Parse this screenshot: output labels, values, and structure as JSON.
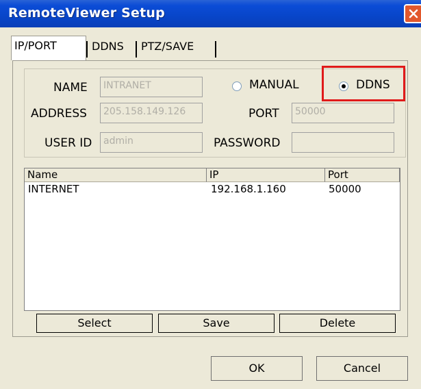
{
  "window": {
    "title": "RemoteViewer Setup"
  },
  "tabs": [
    {
      "label": "IP/PORT",
      "active": true
    },
    {
      "label": "DDNS",
      "active": false
    },
    {
      "label": "PTZ/SAVE",
      "active": false
    }
  ],
  "form": {
    "name_label": "NAME",
    "name_value": "INTRANET",
    "mode_manual_label": "MANUAL",
    "mode_ddns_label": "DDNS",
    "mode_selected": "DDNS",
    "address_label": "ADDRESS",
    "address_value": "205.158.149.126",
    "port_label": "PORT",
    "port_value": "50000",
    "userid_label": "USER ID",
    "userid_value": "admin",
    "password_label": "PASSWORD",
    "password_value": ""
  },
  "table": {
    "columns": [
      "Name",
      "IP",
      "Port"
    ],
    "rows": [
      {
        "name": "INTERNET",
        "ip": "192.168.1.160",
        "port": "50000"
      }
    ]
  },
  "list_buttons": {
    "select": "Select",
    "save": "Save",
    "delete": "Delete"
  },
  "dialog_buttons": {
    "ok": "OK",
    "cancel": "Cancel"
  },
  "colors": {
    "highlight": "#e01a1a",
    "titlebar": "#0845c9"
  }
}
